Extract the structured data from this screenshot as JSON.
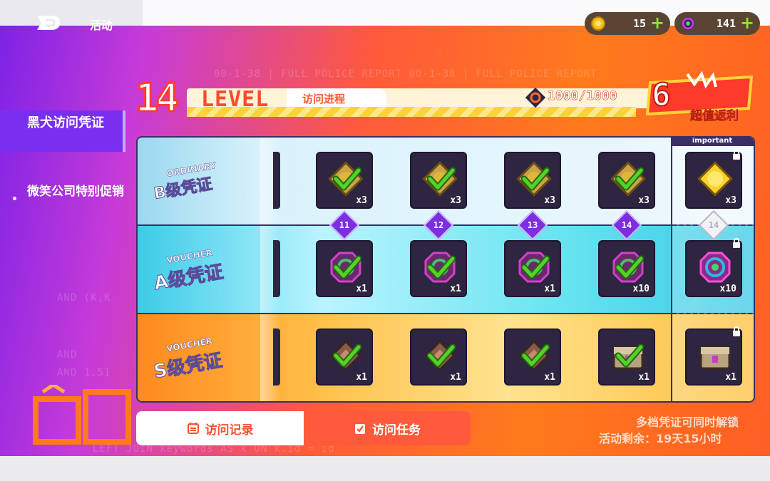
{
  "topbar": {
    "title": "活动",
    "currencies": [
      {
        "icon": "gold-gear-coin-icon",
        "value": "15"
      },
      {
        "icon": "purple-ring-gem-icon",
        "value": "141"
      }
    ]
  },
  "sidebar": {
    "items": [
      {
        "label": "黑犬访问凭证",
        "active": true
      },
      {
        "label": "微笑公司特别促销",
        "active": false
      }
    ]
  },
  "header": {
    "level_number": "14",
    "level_word": "LEVEL",
    "progress_tab": "访问进程",
    "exp": "1000/1000",
    "promo_label": "超值返利",
    "promo_big": "6"
  },
  "rows": [
    {
      "id": "b",
      "tag": "ORDINARY",
      "title": "B级凭证"
    },
    {
      "id": "a",
      "tag": "VOUCHER",
      "title": "A级凭证"
    },
    {
      "id": "s",
      "tag": "VOUCHER",
      "title": "S级凭证"
    }
  ],
  "levels": [
    "11",
    "12",
    "13",
    "14"
  ],
  "important_level": "14",
  "important_label": "important",
  "rewards": {
    "b": [
      {
        "qty": "x3",
        "claimed": true
      },
      {
        "qty": "x3",
        "claimed": true
      },
      {
        "qty": "x3",
        "claimed": true
      },
      {
        "qty": "x3",
        "claimed": true
      }
    ],
    "b_important": {
      "qty": "x3",
      "locked": true
    },
    "a": [
      {
        "qty": "x1",
        "claimed": true
      },
      {
        "qty": "x1",
        "claimed": true
      },
      {
        "qty": "x1",
        "claimed": true
      },
      {
        "qty": "x10",
        "claimed": true
      }
    ],
    "a_important": {
      "qty": "x10",
      "locked": true
    },
    "s": [
      {
        "qty": "x1",
        "claimed": true
      },
      {
        "qty": "x1",
        "claimed": true
      },
      {
        "qty": "x1",
        "claimed": true
      },
      {
        "qty": "x1",
        "claimed": true
      }
    ],
    "s_important": {
      "qty": "x1",
      "locked": true
    }
  },
  "buttons": {
    "record": "访问记录",
    "task": "访问任务"
  },
  "notes": {
    "unlock": "多档凭证可同时解锁",
    "remaining": "活动剩余：19天15小时"
  },
  "colors": {
    "accent": "#ff5a3c",
    "sidebar_active": "#7a2ef0",
    "check": "#57d12a"
  }
}
